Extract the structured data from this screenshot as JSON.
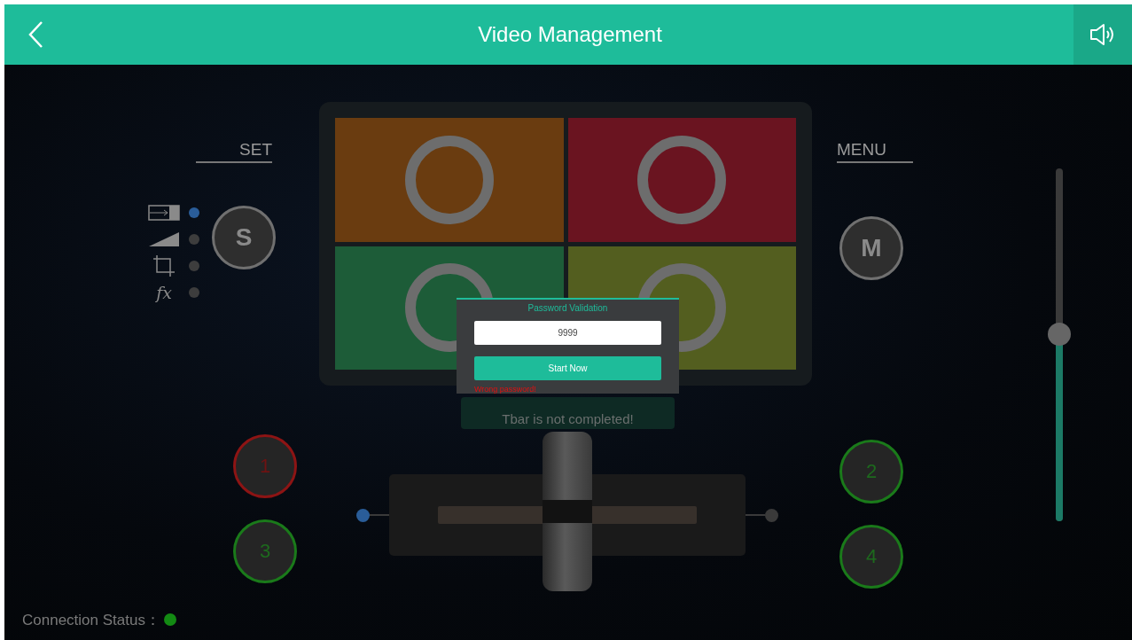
{
  "header": {
    "title": "Video Management"
  },
  "set_panel": {
    "label": "SET",
    "button": "S",
    "modes": [
      {
        "kind": "scale",
        "selected": true
      },
      {
        "kind": "fade",
        "selected": false
      },
      {
        "kind": "crop",
        "selected": false
      },
      {
        "kind": "effect",
        "glyph": "fx",
        "selected": false
      }
    ]
  },
  "menu_panel": {
    "label": "MENU",
    "button": "M"
  },
  "preview": {
    "sources": [
      {
        "color": "#6a3c10"
      },
      {
        "color": "#6a1420"
      },
      {
        "color": "#1d5c38"
      },
      {
        "color": "#535e1f"
      }
    ]
  },
  "sources": [
    {
      "label": "1",
      "live": true
    },
    {
      "label": "2",
      "live": false
    },
    {
      "label": "3",
      "live": false
    },
    {
      "label": "4",
      "live": false
    }
  ],
  "tbar": {
    "level": 0.5,
    "endpoints": [
      {
        "selected": true
      },
      {
        "selected": false
      }
    ]
  },
  "volume": {
    "level": 0.53
  },
  "toast": {
    "text": "Tbar is not completed!"
  },
  "dialog": {
    "title": "Password Validation",
    "value": "9999",
    "button": "Start Now",
    "error": "Wrong password!"
  },
  "status": {
    "label": "Connection Status：",
    "connected": true
  }
}
